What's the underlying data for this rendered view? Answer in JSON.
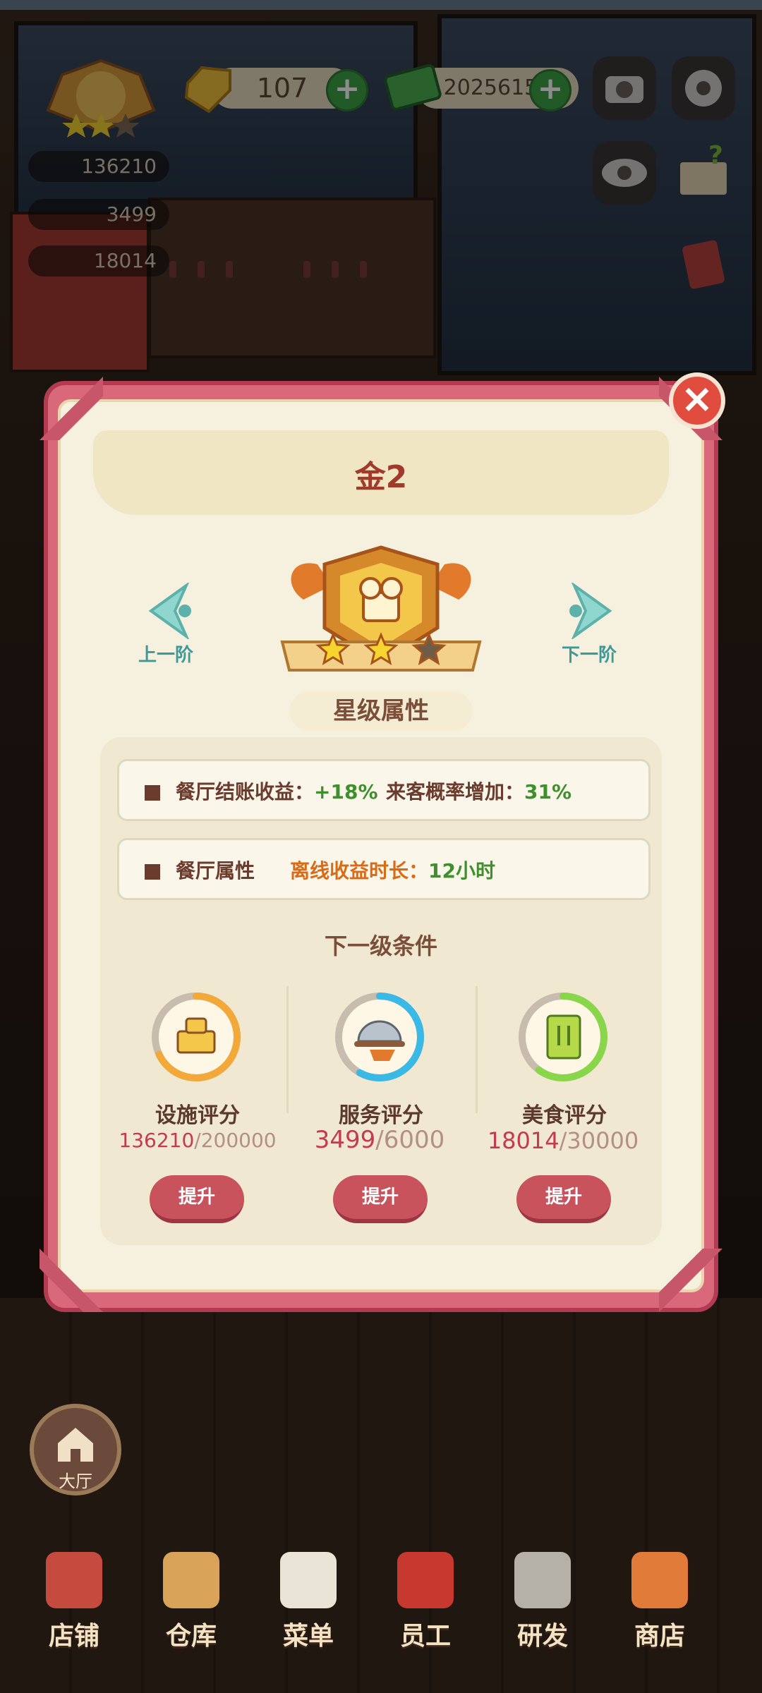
{
  "hud": {
    "gems": "107",
    "cash": "20256150",
    "stats": [
      "136210",
      "3499",
      "18014"
    ],
    "icons": [
      "trophy-icon",
      "gem-icon",
      "cash-icon",
      "camera-icon",
      "gear-icon",
      "eye-icon",
      "help-book-icon",
      "recipe-book-icon"
    ]
  },
  "modal": {
    "title": "金2",
    "prev_label": "上一阶",
    "next_label": "下一阶",
    "stars": {
      "filled": 2,
      "total": 3
    },
    "subtitle": "星级属性",
    "attr_row1": {
      "label": "餐厅结账收益",
      "value": "+18%",
      "label2": "来客概率增加",
      "value2": "31%"
    },
    "attr_row2": {
      "label": "餐厅属性",
      "offline_label": "离线收益时长",
      "offline_value": "12小时"
    },
    "conditions_title": "下一级条件",
    "conditions": [
      {
        "label": "设施评分",
        "current": "136210",
        "max": "/200000",
        "progress": 0.68,
        "button": "提升",
        "ring_color": "#f2a93a"
      },
      {
        "label": "服务评分",
        "current": "3499",
        "max": "/6000",
        "progress": 0.58,
        "button": "提升",
        "ring_color": "#3ab8e6"
      },
      {
        "label": "美食评分",
        "current": "18014",
        "max": "/30000",
        "progress": 0.6,
        "button": "提升",
        "ring_color": "#8ad64a"
      }
    ]
  },
  "hall_label": "大厅",
  "bottom_nav": [
    "店铺",
    "仓库",
    "菜单",
    "员工",
    "研发",
    "商店"
  ]
}
